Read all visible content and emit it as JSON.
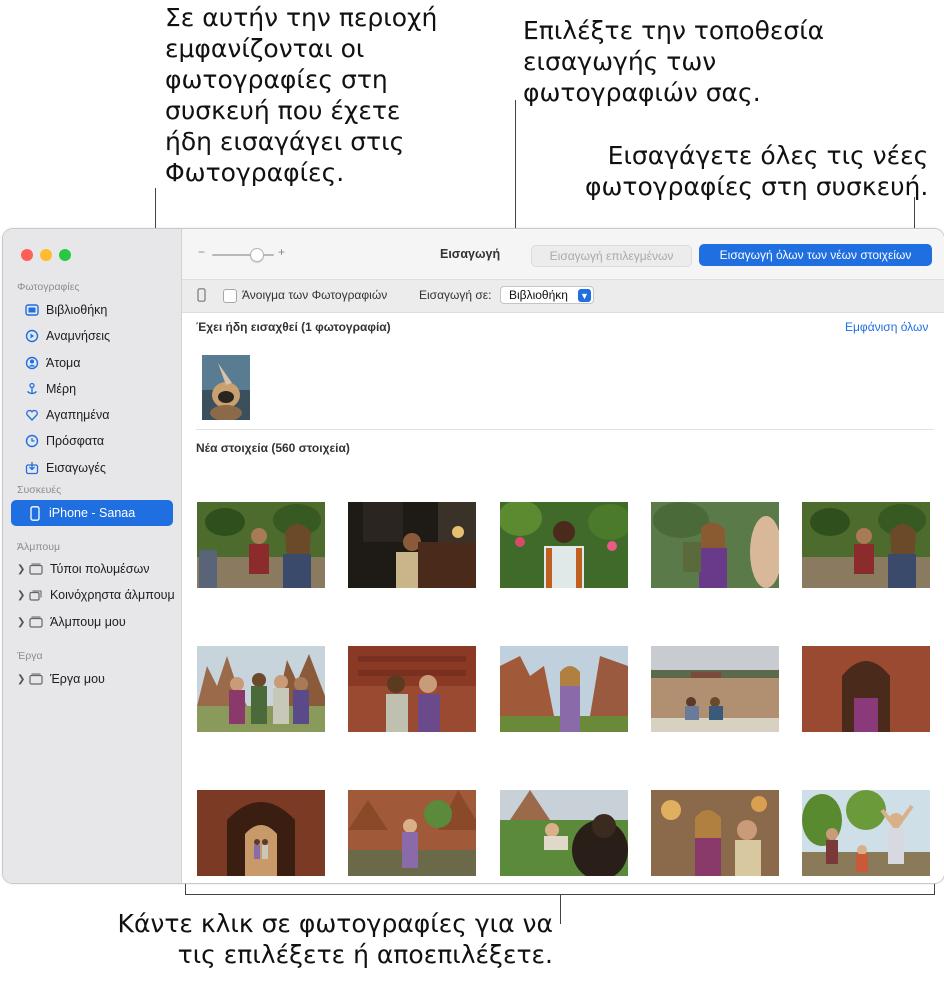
{
  "callouts": {
    "imported_area": "Σε αυτήν την περιοχή\nεμφανίζονται οι\nφωτογραφίες στη\nσυσκευή που έχετε\nήδη εισαγάγει στις\nΦωτογραφίες.",
    "import_location": "Επιλέξτε την τοποθεσία\nεισαγωγής των\nφωτογραφιών σας.",
    "import_all": "Εισαγάγετε όλες τις νέες\nφωτογραφίες στη συσκευή.",
    "click_photos": "Κάντε κλικ σε φωτογραφίες για να\nτις επιλέξετε ή αποεπιλέξετε."
  },
  "sidebar": {
    "photos_section": "Φωτογραφίες",
    "items": [
      {
        "label": "Βιβλιοθήκη",
        "icon": "library-icon"
      },
      {
        "label": "Αναμνήσεις",
        "icon": "memories-icon"
      },
      {
        "label": "Άτομα",
        "icon": "people-icon"
      },
      {
        "label": "Μέρη",
        "icon": "places-icon"
      },
      {
        "label": "Αγαπημένα",
        "icon": "heart-icon"
      },
      {
        "label": "Πρόσφατα",
        "icon": "clock-icon"
      },
      {
        "label": "Εισαγωγές",
        "icon": "import-icon"
      }
    ],
    "devices_section": "Συσκευές",
    "device": "iPhone - Sanaa",
    "albums_section": "Άλμπουμ",
    "albums": [
      {
        "label": "Τύποι πολυμέσων"
      },
      {
        "label": "Κοινόχρηστα άλμπουμ"
      },
      {
        "label": "Άλμπουμ μου"
      }
    ],
    "projects_section": "Έργα",
    "projects": [
      {
        "label": "Έργα μου"
      }
    ]
  },
  "toolbar": {
    "title": "Εισαγωγή",
    "import_selected": "Εισαγωγή επιλεγμένων",
    "import_all_new": "Εισαγωγή όλων των νέων στοιχείων"
  },
  "options": {
    "open_photos": "Άνοιγμα των Φωτογραφιών",
    "import_to_label": "Εισαγωγή σε:",
    "import_to_value": "Βιβλιοθήκη"
  },
  "already_imported": {
    "heading": "Έχει ήδη εισαχθεί (1 φωτογραφία)",
    "show_all": "Εμφάνιση όλων"
  },
  "new_items": {
    "heading": "Νέα στοιχεία (560 στοιχεία)"
  },
  "colors": {
    "accent": "#1f6fe0",
    "sidebar_bg": "#e7e7ea",
    "close": "#fe5f57",
    "minimize": "#febc2e",
    "zoom": "#28c840"
  }
}
